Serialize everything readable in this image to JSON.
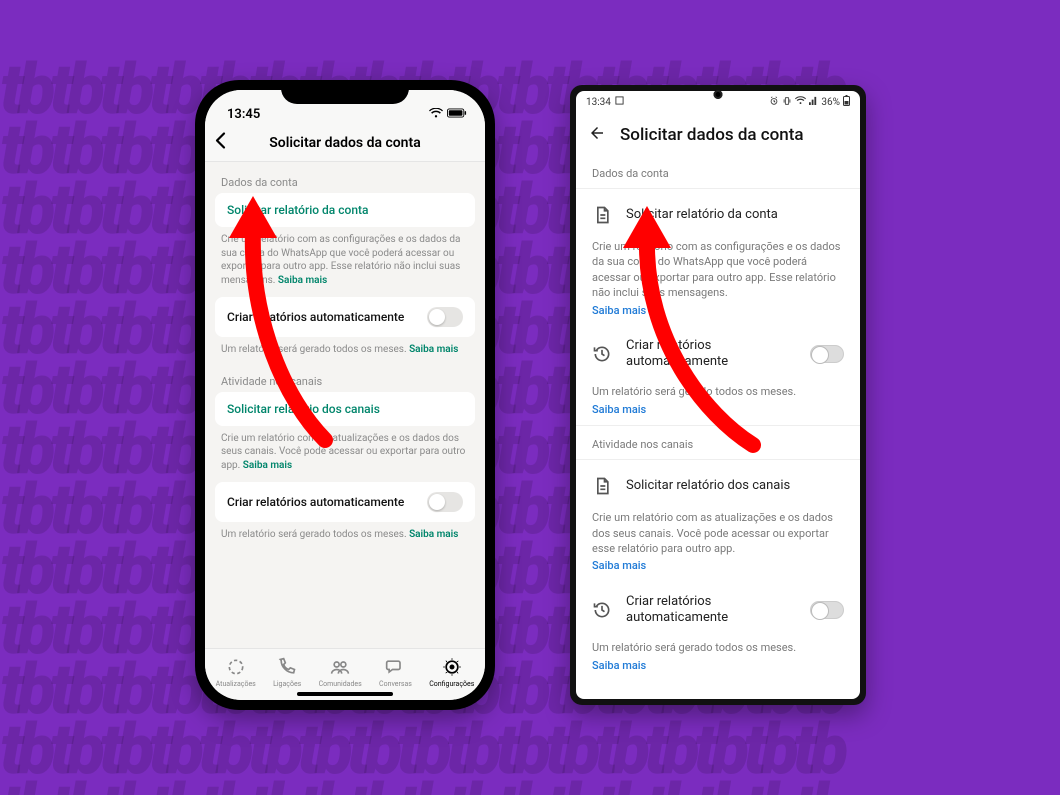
{
  "background": {
    "color": "#7b2cbf",
    "pattern_text": "tbtbtbtbtbtbtbtbtbtbtbtbtbtbtbtbtb"
  },
  "ios": {
    "statusbar": {
      "time": "13:45"
    },
    "title": "Solicitar dados da conta",
    "section1": {
      "label": "Dados da conta",
      "request_account": "Solicitar relatório da conta",
      "desc_prefix": "Crie um relatório com as configurações e os dados da sua conta do WhatsApp que você poderá acessar ou exportar para outro app. Esse relatório não inclui suas mensagens. ",
      "desc_link": "Saiba mais",
      "auto_label": "Criar relatórios automaticamente",
      "auto_desc_prefix": "Um relatório será gerado todos os meses. ",
      "auto_desc_link": "Saiba mais"
    },
    "section2": {
      "label": "Atividade nos canais",
      "request_channels": "Solicitar relatório dos canais",
      "desc_prefix": "Crie um relatório com as atualizações e os dados dos seus canais. Você pode acessar ou exportar para outro app. ",
      "desc_link": "Saiba mais",
      "auto_label": "Criar relatórios automaticamente",
      "auto_desc_prefix": "Um relatório será gerado todos os meses. ",
      "auto_desc_link": "Saiba mais"
    },
    "tabs": {
      "updates": "Atualizações",
      "calls": "Ligações",
      "communities": "Comunidades",
      "chats": "Conversas",
      "settings": "Configurações"
    }
  },
  "android": {
    "statusbar": {
      "time": "13:34",
      "battery": "36%"
    },
    "title": "Solicitar dados da conta",
    "section1": {
      "label": "Dados da conta",
      "request_account": "Solicitar relatório da conta",
      "desc": "Crie um relatório com as configurações e os dados da sua conta do WhatsApp que você poderá acessar ou exportar para outro app. Esse relatório não inclui suas mensagens.",
      "desc_link": "Saiba mais",
      "auto_label": "Criar relatórios automaticamente",
      "auto_desc": "Um relatório será gerado todos os meses.",
      "auto_desc_link": "Saiba mais"
    },
    "section2": {
      "label": "Atividade nos canais",
      "request_channels": "Solicitar relatório dos canais",
      "desc": "Crie um relatório com as atualizações e os dados dos seus canais. Você pode acessar ou exportar esse relatório para outro app.",
      "desc_link": "Saiba mais",
      "auto_label": "Criar relatórios automaticamente",
      "auto_desc": "Um relatório será gerado todos os meses.",
      "auto_desc_link": "Saiba mais"
    }
  },
  "arrows": {
    "color": "#ff0000"
  }
}
